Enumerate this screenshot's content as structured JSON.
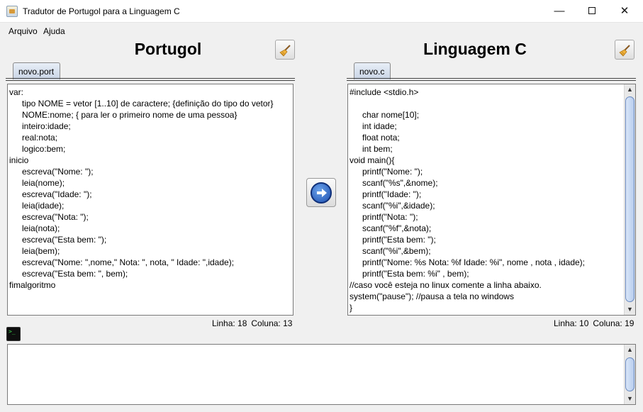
{
  "window": {
    "title": "Tradutor de Portugol para a Linguagem C",
    "controls": {
      "minimize": "—",
      "close": "✕"
    }
  },
  "menu": {
    "items": [
      {
        "label": "Arquivo"
      },
      {
        "label": "Ajuda"
      }
    ]
  },
  "left_pane": {
    "title": "Portugol",
    "tab_label": "novo.port",
    "code": [
      {
        "indent": 0,
        "text": "var:"
      },
      {
        "indent": 1,
        "text": "tipo NOME = vetor [1..10] de caractere; {definição do tipo do vetor}"
      },
      {
        "indent": 1,
        "text": "NOME:nome; { para ler o primeiro nome de uma pessoa}"
      },
      {
        "indent": 1,
        "text": "inteiro:idade;"
      },
      {
        "indent": 1,
        "text": "real:nota;"
      },
      {
        "indent": 1,
        "text": "logico:bem;"
      },
      {
        "indent": 0,
        "text": "inicio"
      },
      {
        "indent": 1,
        "text": "escreva(\"Nome: \");"
      },
      {
        "indent": 1,
        "text": "leia(nome);"
      },
      {
        "indent": 1,
        "text": "escreva(\"Idade: \");"
      },
      {
        "indent": 1,
        "text": "leia(idade);"
      },
      {
        "indent": 1,
        "text": "escreva(\"Nota: \");"
      },
      {
        "indent": 1,
        "text": "leia(nota);"
      },
      {
        "indent": 1,
        "text": "escreva(\"Esta bem: \");"
      },
      {
        "indent": 1,
        "text": "leia(bem);"
      },
      {
        "indent": 1,
        "text": "escreva(\"Nome: \",nome,\" Nota: \", nota, \" Idade: \",idade);"
      },
      {
        "indent": 1,
        "text": "escreva(\"Esta bem: \", bem);"
      },
      {
        "indent": 0,
        "text": "fimalgoritmo"
      }
    ],
    "status": {
      "line_label": "Linha: 18",
      "column_label": "Coluna: 13"
    }
  },
  "right_pane": {
    "title": "Linguagem C",
    "tab_label": "novo.c",
    "code": [
      {
        "indent": 0,
        "text": "#include <stdio.h>"
      },
      {
        "indent": 0,
        "text": ""
      },
      {
        "indent": 1,
        "text": "char nome[10];"
      },
      {
        "indent": 1,
        "text": "int idade;"
      },
      {
        "indent": 1,
        "text": "float nota;"
      },
      {
        "indent": 1,
        "text": "int bem;"
      },
      {
        "indent": 0,
        "text": "void main(){"
      },
      {
        "indent": 1,
        "text": "printf(\"Nome: \");"
      },
      {
        "indent": 1,
        "text": "scanf(\"%s\",&nome);"
      },
      {
        "indent": 1,
        "text": "printf(\"Idade: \");"
      },
      {
        "indent": 1,
        "text": "scanf(\"%i\",&idade);"
      },
      {
        "indent": 1,
        "text": "printf(\"Nota: \");"
      },
      {
        "indent": 1,
        "text": "scanf(\"%f\",&nota);"
      },
      {
        "indent": 1,
        "text": "printf(\"Esta bem: \");"
      },
      {
        "indent": 1,
        "text": "scanf(\"%i\",&bem);"
      },
      {
        "indent": 1,
        "text": "printf(\"Nome: %s Nota: %f Idade: %i\", nome , nota , idade);"
      },
      {
        "indent": 1,
        "text": "printf(\"Esta bem: %i\" , bem);"
      },
      {
        "indent": 0,
        "text": "//caso você esteja no linux comente a linha abaixo."
      },
      {
        "indent": 0,
        "text": "system(\"pause\"); //pausa a tela no windows"
      },
      {
        "indent": 0,
        "text": "}"
      }
    ],
    "status": {
      "line_label": "Linha: 10",
      "column_label": "Coluna: 19"
    }
  },
  "console": {
    "text": ""
  },
  "icons": {
    "app": "app-icon",
    "clean": "broom-icon",
    "translate": "arrow-right-icon",
    "terminal": "terminal-icon"
  },
  "colors": {
    "tab_fill": "#c8d4e5",
    "translate_blue": "#1d4fb0",
    "scroll_thumb": "#b8cdee"
  }
}
